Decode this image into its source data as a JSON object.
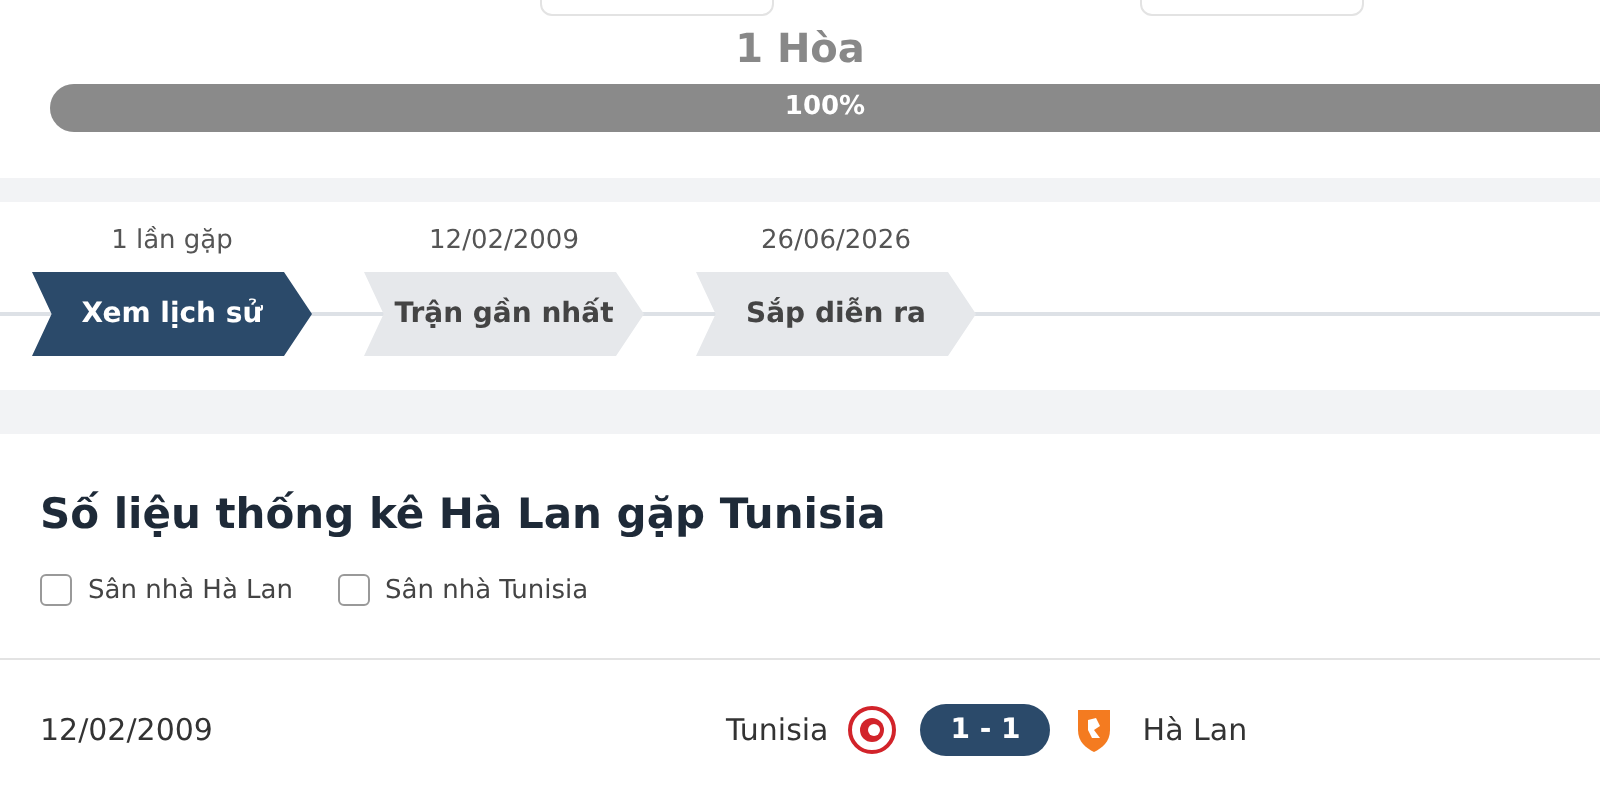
{
  "summary": {
    "draws": "1 Hòa",
    "bar": {
      "level": 1,
      "label": "100%"
    }
  },
  "timeline": [
    {
      "caption": "1 lần gặp",
      "label": "Xem lịch sử",
      "selected": true
    },
    {
      "caption": "12/02/2009",
      "label": "Trận gần nhất",
      "selected": false
    },
    {
      "caption": "26/06/2026",
      "label": "Sắp diễn ra",
      "selected": false
    }
  ],
  "stats": {
    "title": "Số liệu thống kê Hà Lan gặp Tunisia",
    "filters": [
      {
        "label": "Sân nhà Hà Lan",
        "checked": false
      },
      {
        "label": "Sân nhà Tunisia",
        "checked": false
      }
    ]
  },
  "matches": [
    {
      "date": "12/02/2009",
      "home": "Tunisia",
      "score": "1 - 1",
      "away": "Hà Lan"
    }
  ]
}
